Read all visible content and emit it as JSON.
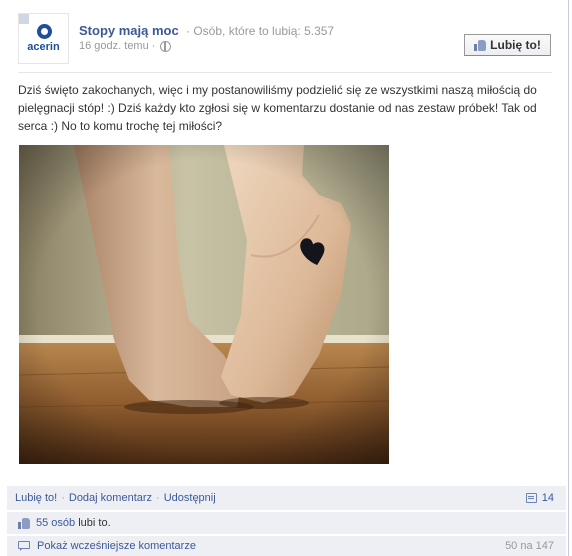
{
  "page": {
    "name": "Stopy mają moc",
    "likes_text": "Osób, które to lubią: 5.357",
    "time": "16 godz. temu",
    "logo_text": "acerin"
  },
  "like_button": {
    "label": "Lubię to!",
    "icon": "thumb-up-icon"
  },
  "post": {
    "text": "Dziś święto zakochanych, więc i my postanowiliśmy podzielić się ze wszystkimi naszą miłością do pielęgnacji stóp! :) Dziś każdy kto zgłosi się w komentarzu dostanie od nas zestaw próbek! Tak od serca :) No to komu trochę tej miłości?"
  },
  "actions": {
    "like": "Lubię to!",
    "comment": "Dodaj komentarz",
    "share": "Udostępnij",
    "comment_count": "14"
  },
  "likes_bar": {
    "count_link": "55 osób",
    "suffix": " lubi to."
  },
  "more_comments": {
    "label": "Pokaż wcześniejsze komentarze",
    "page": "50 na 147"
  },
  "colors": {
    "link": "#3b5998",
    "bar_bg": "#edeff4",
    "muted": "#999999"
  }
}
